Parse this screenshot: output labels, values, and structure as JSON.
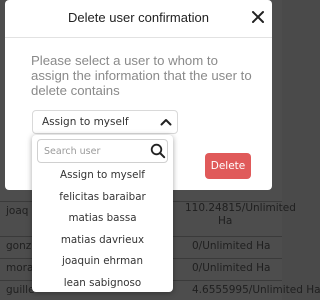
{
  "background_table": {
    "rows": [
      {
        "c1": "joaq",
        "c2": "110.24815/Unlimited",
        "c2b": "Ha"
      },
      {
        "c1": "gonz",
        "c3": "0/Unlimited Ha"
      },
      {
        "c1": "mora",
        "c3": "0/Unlimited Ha"
      },
      {
        "c1": "guille",
        "c3": "4.6555995/Unlimited Ha"
      }
    ]
  },
  "modal": {
    "title": "Delete user confirmation",
    "prompt": "Please select a user to whom to assign the information that the user to delete contains",
    "select_value": "Assign to myself",
    "delete_label": "Delete"
  },
  "dropdown": {
    "search_placeholder": "Search user",
    "search_value": "",
    "options": [
      "Assign to myself",
      "felicitas baraibar",
      "matias bassa",
      "matias davrieux",
      "joaquin ehrman",
      "lean sabignoso"
    ]
  },
  "colors": {
    "overlay": "#4d4d4d",
    "delete_button": "#e05a5a",
    "prompt_text": "#8a8a8a"
  }
}
